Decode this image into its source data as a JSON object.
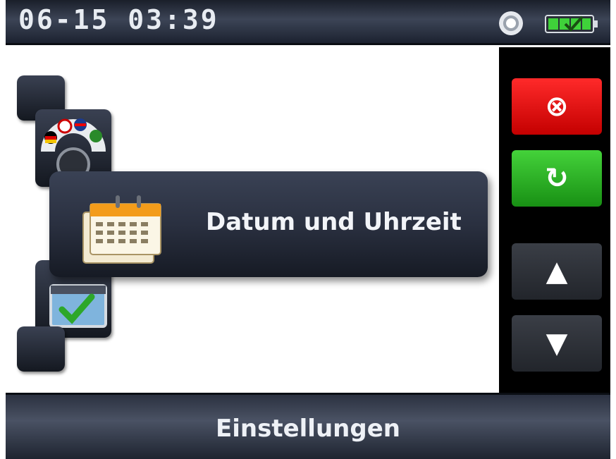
{
  "status_bar": {
    "time": "06-15 03:39",
    "icons": [
      "gps-icon",
      "battery-charging-icon"
    ]
  },
  "menu": {
    "selected_label": "Datum und Uhrzeit",
    "items": [
      {
        "icon": "blank-tile-icon"
      },
      {
        "icon": "language-flags-icon"
      },
      {
        "icon": "calendar-icon",
        "selected": true
      },
      {
        "icon": "checkmark-window-icon"
      },
      {
        "icon": "blank-tile-icon"
      }
    ]
  },
  "controls": {
    "cancel_glyph": "⊗",
    "refresh_glyph": "↻",
    "up_glyph": "▲",
    "down_glyph": "▼"
  },
  "footer": {
    "title": "Einstellungen"
  },
  "colors": {
    "cancel": "#e00000",
    "confirm": "#2bb024",
    "bar_dark": "#1c2230",
    "text_light": "#f2f4f8"
  }
}
